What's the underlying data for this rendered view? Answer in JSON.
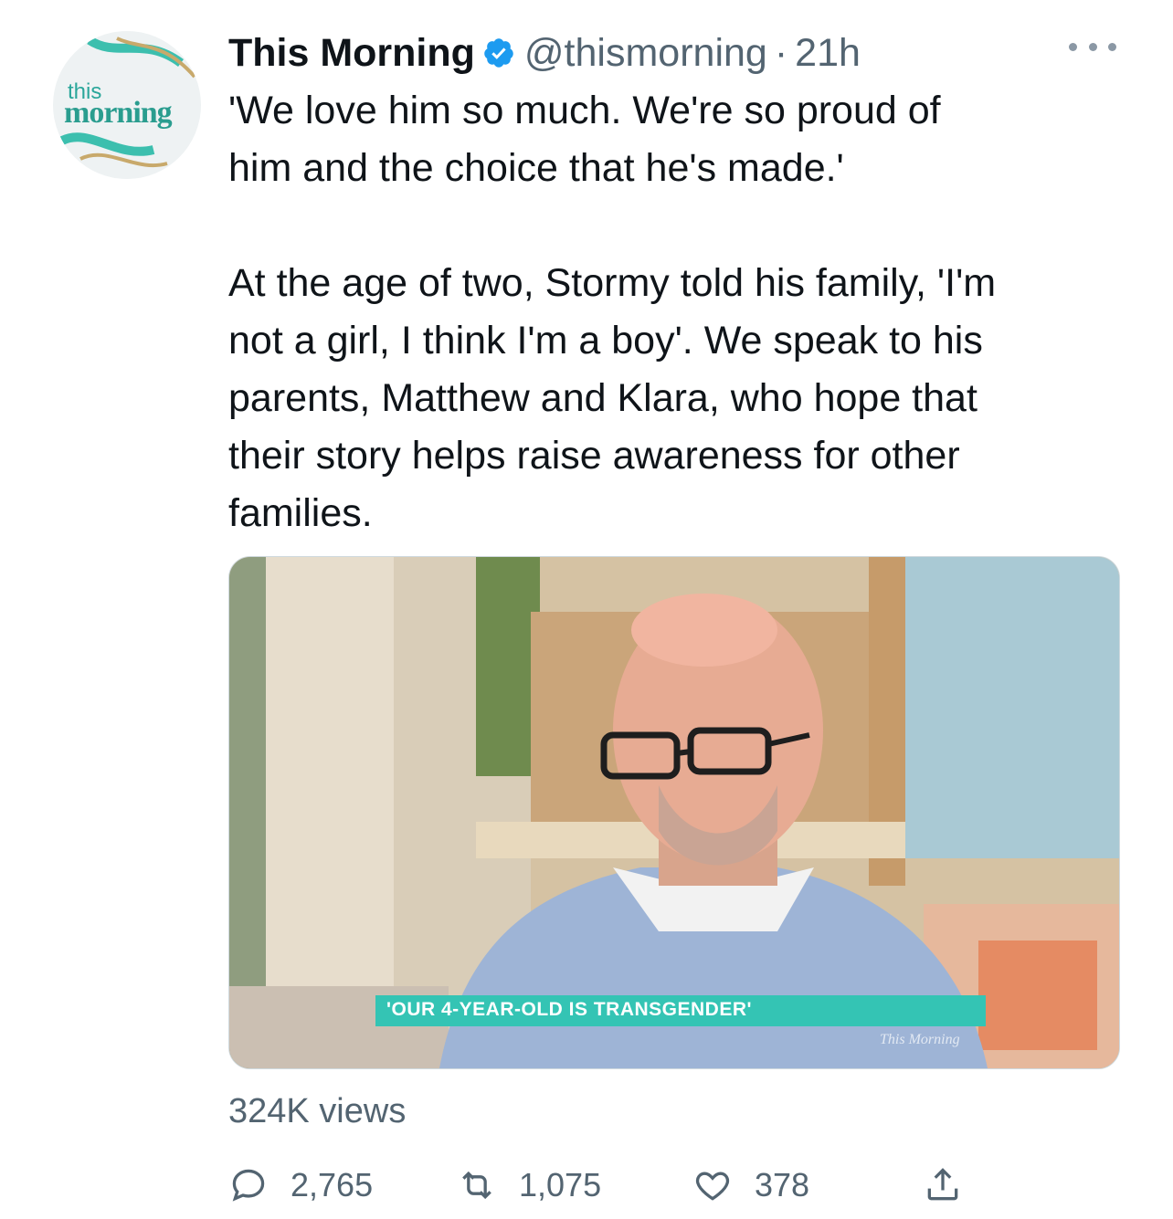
{
  "tweet": {
    "display_name": "This Morning",
    "handle": "@thismorning",
    "separator": "·",
    "time": "21h",
    "avatar": {
      "line1": "this",
      "line2": "morning"
    },
    "text": "'We love him so much. We're so proud of\nhim and the choice that he's made.'\n\nAt the age of two, Stormy told his family, 'I'm\nnot a girl, I think I'm a boy'. We speak to his\nparents, Matthew and Klara, who hope that\ntheir story helps raise awareness for other\nfamilies.",
    "media": {
      "caption": "'OUR 4-YEAR-OLD IS TRANSGENDER'",
      "watermark": "This Morning"
    },
    "views": "324K views",
    "actions": {
      "replies": "2,765",
      "retweets": "1,075",
      "likes": "378"
    }
  },
  "colors": {
    "text": "#0f1419",
    "secondary": "#536471",
    "verified": "#1d9bf0",
    "caption_bg": "#34c4b4"
  },
  "icons": [
    "verified-badge-icon",
    "more-icon",
    "reply-icon",
    "retweet-icon",
    "like-icon",
    "share-icon"
  ]
}
